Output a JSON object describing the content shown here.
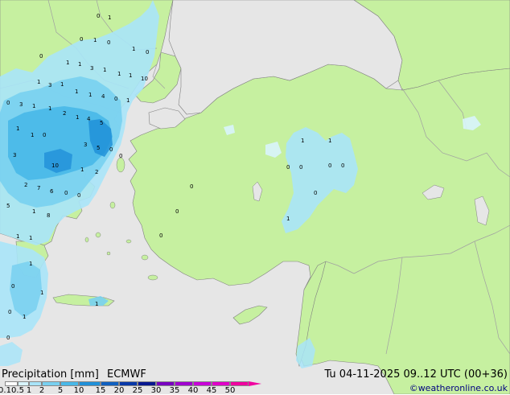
{
  "title": {
    "left_parts": [
      "Precipitation [mm]",
      "ECMWF"
    ],
    "right": "Tu 04-11-2025 09..12 UTC (00+36)",
    "credit": "©weatheronline.co.uk"
  },
  "legend": {
    "ticks": [
      "0.1",
      "0.5",
      "1",
      "2",
      "5",
      "10",
      "15",
      "20",
      "25",
      "30",
      "35",
      "40",
      "45",
      "50"
    ],
    "colors": [
      "#ffffff",
      "#d8f4fc",
      "#a8e4f8",
      "#78d0f0",
      "#48b8e8",
      "#2090d8",
      "#1060c0",
      "#0838a8",
      "#081890",
      "#7800c0",
      "#a000d0",
      "#c800d8",
      "#e000c8",
      "#f000a0"
    ]
  },
  "colors": {
    "sea": "#e6e6e6",
    "land": "#c6f0a0",
    "border": "#a0a0a0",
    "coast": "#808080"
  },
  "map_labels": [
    "0",
    "1",
    "0",
    "1",
    "0",
    "1",
    "0",
    "1",
    "1",
    "3",
    "1",
    "1",
    "1",
    "0",
    "10",
    "1",
    "3",
    "1",
    "0",
    "3",
    "1",
    "1",
    "1",
    "4",
    "0",
    "1",
    "1",
    "4",
    "5",
    "2",
    "1",
    "1",
    "3",
    "5",
    "0",
    "3",
    "1",
    "0",
    "10",
    "1",
    "2",
    "5",
    "2",
    "7",
    "6",
    "0",
    "0",
    "1",
    "8",
    "1",
    "1",
    "1",
    "0",
    "1",
    "1",
    "0",
    "0",
    "1",
    "0",
    "0",
    "1",
    "0",
    "0",
    "0",
    "0",
    "1",
    "1",
    "0",
    "0",
    "0"
  ]
}
